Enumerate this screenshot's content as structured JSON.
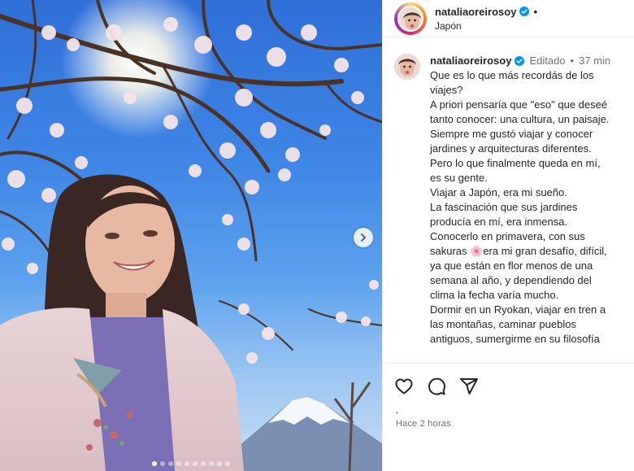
{
  "post": {
    "username": "nataliaoreirosoy",
    "location": "Japón",
    "separator": "•",
    "caption": {
      "edited_label": "Editado",
      "age": "37 min",
      "lines": [
        "Que es lo que más recordás de los",
        "viajes?",
        "A priori pensaría que \"eso\" que deseé",
        "tanto conocer: una cultura, un paisaje.",
        "Siempre me gustó viajar y conocer",
        "jardines y arquitecturas diferentes.",
        "Pero lo que finalmente queda en mí,",
        "es su gente.",
        "Viajar a Japón, era mi sueño.",
        "La fascinación que sus jardines",
        "producía en mí, era inmensa.",
        "Conocerlo en primavera, con sus"
      ],
      "sakura_before": "sakuras ",
      "sakura_emoji": "🌸",
      "sakura_after": "era mi gran desafío, difícil,",
      "lines_after": [
        "ya que están en flor menos de una",
        "semana al año, y dependiendo del",
        "clima la fecha varía mucho.",
        "Dormir en un Ryokan, viajar en tren a",
        "las montañas, caminar pueblos",
        "antiguos, sumergirme en su filosofía"
      ]
    },
    "timestamp": "Hace 2 horas",
    "timestamp_dot": "•",
    "carousel": {
      "total_slides": 10,
      "active_index": 0
    },
    "icons": {
      "like": "heart-icon",
      "comment": "comment-icon",
      "share": "share-icon",
      "next": "chevron-right-icon",
      "verified": "verified-badge-icon"
    },
    "colors": {
      "verified": "#0095f6",
      "sky_top": "#2f6fd8",
      "blossom": "#f3dfe3"
    }
  }
}
